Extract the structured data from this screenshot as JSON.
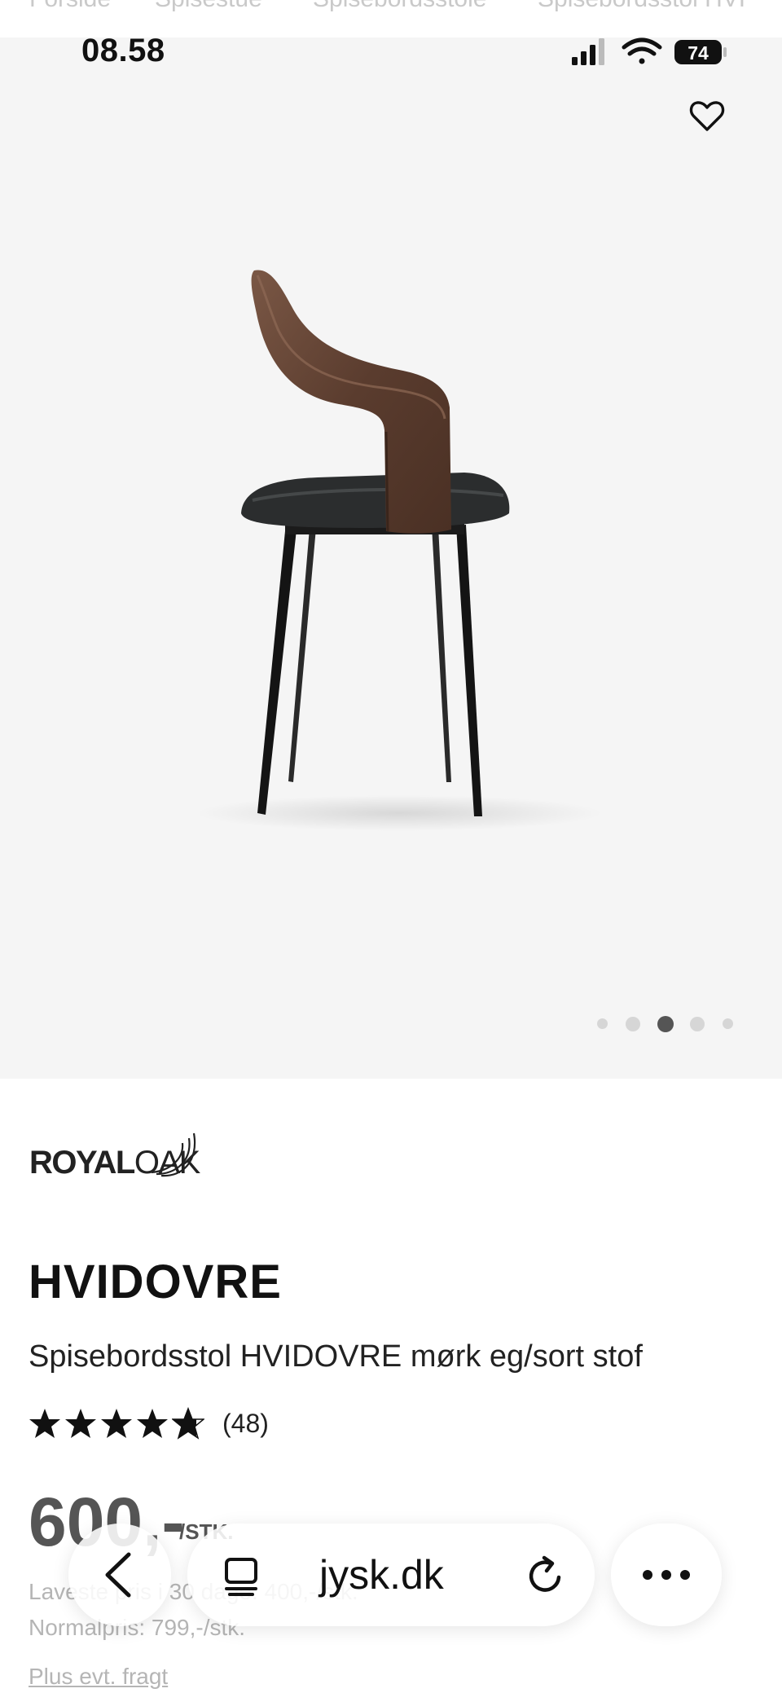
{
  "status_bar": {
    "time": "08.58",
    "battery": "74"
  },
  "breadcrumbs": [
    "Forside",
    "Spisestue",
    "Spisebordsstole",
    "Spisebordsstol HVI"
  ],
  "product": {
    "brand_logo_text_1": "ROYAL",
    "brand_logo_text_2": "OAK",
    "name": "HVIDOVRE",
    "description": "Spisebordsstol HVIDOVRE mørk eg/sort stof",
    "rating": 4.7,
    "rating_count": "(48)",
    "price": "600,-",
    "price_unit": "/STK.",
    "lowest_price_text": "Laveste pris i 30 dage: 400,-/stk.",
    "normal_price_text": "Normalpris: 799,-/stk.",
    "freight_link": "Plus evt. fragt"
  },
  "carousel": {
    "count": 5,
    "active_index": 2
  },
  "browser": {
    "url": "jysk.dk",
    "back_icon": "chevron-left-icon",
    "tabs_icon": "tabs-icon",
    "reload_icon": "reload-icon",
    "more_icon": "ellipsis-icon"
  }
}
